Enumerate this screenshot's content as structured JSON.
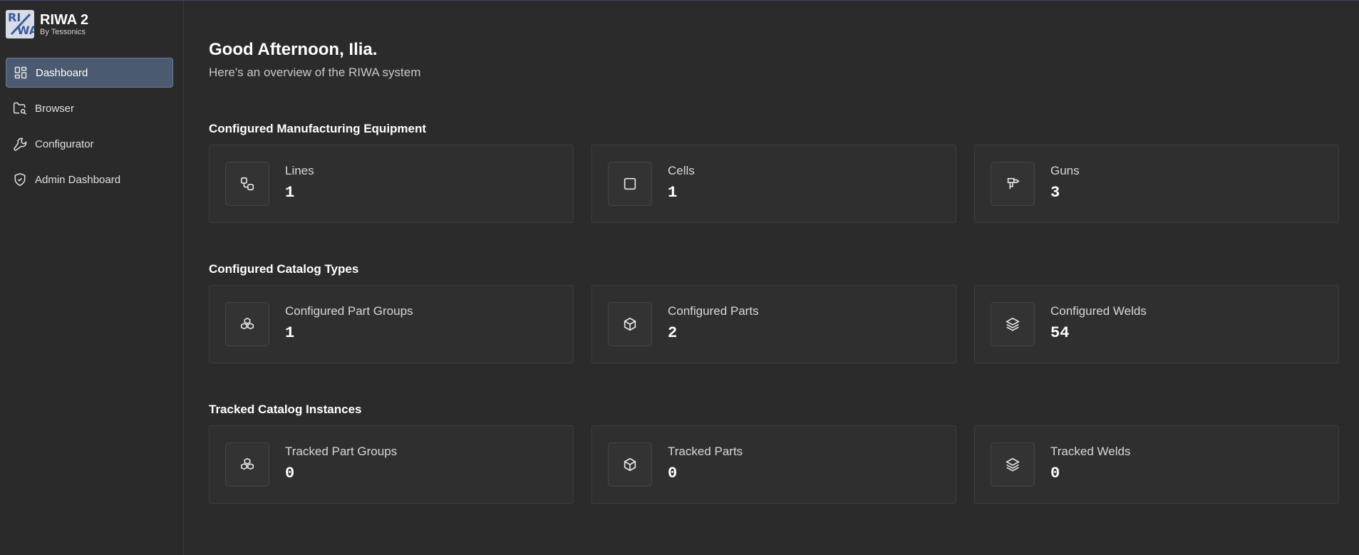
{
  "app": {
    "title": "RIWA 2",
    "subtitle": "By Tessonics",
    "logo_text": [
      "RI",
      "WA"
    ]
  },
  "sidebar": {
    "items": [
      {
        "label": "Dashboard",
        "icon": "dashboard-icon",
        "active": true
      },
      {
        "label": "Browser",
        "icon": "folder-search-icon",
        "active": false
      },
      {
        "label": "Configurator",
        "icon": "wrench-icon",
        "active": false
      },
      {
        "label": "Admin Dashboard",
        "icon": "shield-check-icon",
        "active": false
      }
    ]
  },
  "main": {
    "greeting": "Good Afternoon, Ilia.",
    "subtitle": "Here's an overview of the RIWA system",
    "sections": [
      {
        "title": "Configured Manufacturing Equipment",
        "cards": [
          {
            "label": "Lines",
            "value": "1",
            "icon": "workflow-icon"
          },
          {
            "label": "Cells",
            "value": "1",
            "icon": "square-icon"
          },
          {
            "label": "Guns",
            "value": "3",
            "icon": "weld-gun-icon"
          }
        ]
      },
      {
        "title": "Configured Catalog Types",
        "cards": [
          {
            "label": "Configured Part Groups",
            "value": "1",
            "icon": "boxes-icon"
          },
          {
            "label": "Configured Parts",
            "value": "2",
            "icon": "box-icon"
          },
          {
            "label": "Configured Welds",
            "value": "54",
            "icon": "layers-icon"
          }
        ]
      },
      {
        "title": "Tracked Catalog Instances",
        "cards": [
          {
            "label": "Tracked Part Groups",
            "value": "0",
            "icon": "boxes-icon"
          },
          {
            "label": "Tracked Parts",
            "value": "0",
            "icon": "box-icon"
          },
          {
            "label": "Tracked Welds",
            "value": "0",
            "icon": "layers-icon"
          }
        ]
      }
    ]
  },
  "colors": {
    "background": "#2b2b2b",
    "card": "#2f2f2f",
    "active_nav": "#4b5a70",
    "accent_top": "#4a4270"
  }
}
